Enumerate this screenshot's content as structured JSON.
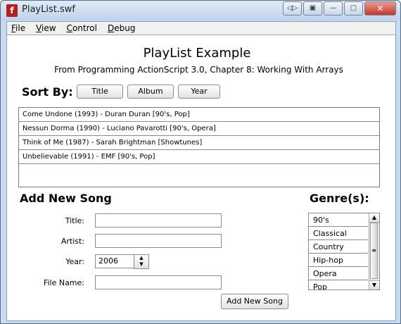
{
  "window": {
    "title": "PlayList.swf",
    "app_icon_glyph": "f",
    "controls": [
      "◁▷",
      "▣",
      "—",
      "▢",
      "✕"
    ]
  },
  "menubar": {
    "items": [
      "File",
      "View",
      "Control",
      "Debug"
    ]
  },
  "heading": {
    "title": "PlayList Example",
    "subtitle": "From Programming ActionScript 3.0, Chapter 8: Working With Arrays"
  },
  "sort": {
    "label": "Sort By:",
    "buttons": [
      "Title",
      "Album",
      "Year"
    ]
  },
  "songs": [
    "Come Undone (1993) - Duran Duran [90's, Pop]",
    "Nessun Dorma (1990) - Luciano Pavarotti [90's, Opera]",
    "Think of Me (1987) - Sarah Brightman [Showtunes]",
    "Unbelievable (1991) - EMF [90's, Pop]"
  ],
  "add_song": {
    "heading": "Add New Song",
    "labels": {
      "title": "Title:",
      "artist": "Artist:",
      "year": "Year:",
      "file": "File Name:"
    },
    "values": {
      "title": "",
      "artist": "",
      "year": "2006",
      "file": ""
    },
    "button": "Add New Song"
  },
  "genres": {
    "heading": "Genre(s):",
    "items": [
      "90's",
      "Classical",
      "Country",
      "Hip-hop",
      "Opera",
      "Pop"
    ]
  },
  "icons": {
    "stepper_up": "▲",
    "stepper_down": "▼",
    "scroll_up": "▲",
    "scroll_down": "▼",
    "thumb_grip": "≡"
  },
  "colors": {
    "title_bar": "#c9dbee",
    "close_button": "#c2382a",
    "app_icon": "#b5201e"
  }
}
